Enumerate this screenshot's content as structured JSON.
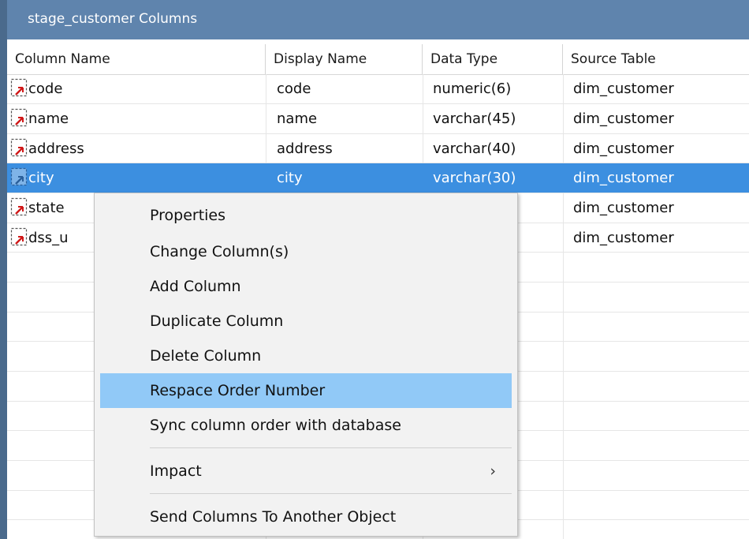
{
  "window": {
    "title": "stage_customer Columns"
  },
  "columns": [
    "Column Name",
    "Display Name",
    "Data Type",
    "Source Table"
  ],
  "rows": [
    {
      "name": "code",
      "display": "code",
      "type": "numeric(6)",
      "source": "dim_customer"
    },
    {
      "name": "name",
      "display": "name",
      "type": "varchar(45)",
      "source": "dim_customer"
    },
    {
      "name": "address",
      "display": "address",
      "type": "varchar(40)",
      "source": "dim_customer"
    },
    {
      "name": "city",
      "display": "city",
      "type": "varchar(30)",
      "source": "dim_customer"
    },
    {
      "name": "state",
      "display": "",
      "type": "",
      "source": "dim_customer"
    },
    {
      "name": "dss_u",
      "display": "",
      "type": "",
      "source": "dim_customer"
    }
  ],
  "selected_row": "city",
  "context_menu": {
    "items": [
      "Properties",
      "Change Column(s)",
      "Add Column",
      "Duplicate Column",
      "Delete Column",
      "Respace Order Number",
      "Sync column order with database",
      "Impact",
      "Send Columns To Another Object"
    ],
    "highlighted": "Respace Order Number",
    "submenu_arrow": "›"
  },
  "colors": {
    "titlebar": "#5f84ad",
    "selection": "#3c8fe0",
    "menu_highlight": "#91c9f7"
  },
  "icons": {
    "column": "column-arrow-icon",
    "submenu": "chevron-right-icon"
  }
}
